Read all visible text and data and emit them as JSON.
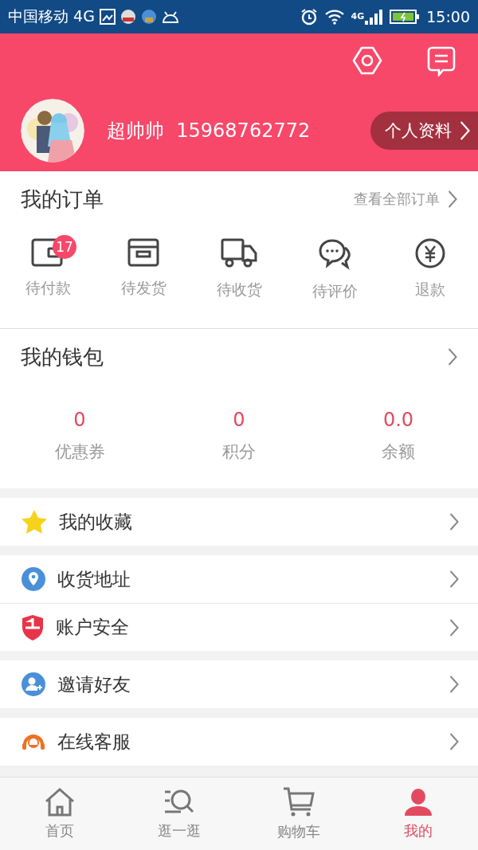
{
  "status_bar": {
    "carrier": "中国移动 4G",
    "network": "4G",
    "time": "15:00"
  },
  "profile": {
    "name": "超帅帅",
    "phone": "15968762772",
    "details_button": "个人资料"
  },
  "orders": {
    "title": "我的订单",
    "view_all": "查看全部订单",
    "items": [
      {
        "kind": "wallet",
        "label": "待付款",
        "badge": "17"
      },
      {
        "kind": "box",
        "label": "待发货"
      },
      {
        "kind": "truck",
        "label": "待收货"
      },
      {
        "kind": "chat",
        "label": "待评价"
      },
      {
        "kind": "refund",
        "label": "退款"
      }
    ]
  },
  "wallet": {
    "title": "我的钱包",
    "stats": [
      {
        "value": "0",
        "label": "优惠券"
      },
      {
        "value": "0",
        "label": "积分"
      },
      {
        "value": "0.0",
        "label": "余额"
      }
    ]
  },
  "menu_groups": [
    [
      {
        "kind": "star",
        "label": "我的收藏"
      }
    ],
    [
      {
        "kind": "location",
        "label": "收货地址"
      },
      {
        "kind": "shield",
        "label": "账户安全"
      }
    ],
    [
      {
        "kind": "invite",
        "label": "邀请好友"
      }
    ],
    [
      {
        "kind": "service",
        "label": "在线客服"
      }
    ]
  ],
  "tab_bar": [
    {
      "kind": "home",
      "label": "首页",
      "selected": false
    },
    {
      "kind": "explore",
      "label": "逛一逛",
      "selected": false
    },
    {
      "kind": "cart",
      "label": "购物车",
      "selected": false
    },
    {
      "kind": "user",
      "label": "我的",
      "selected": true
    }
  ]
}
